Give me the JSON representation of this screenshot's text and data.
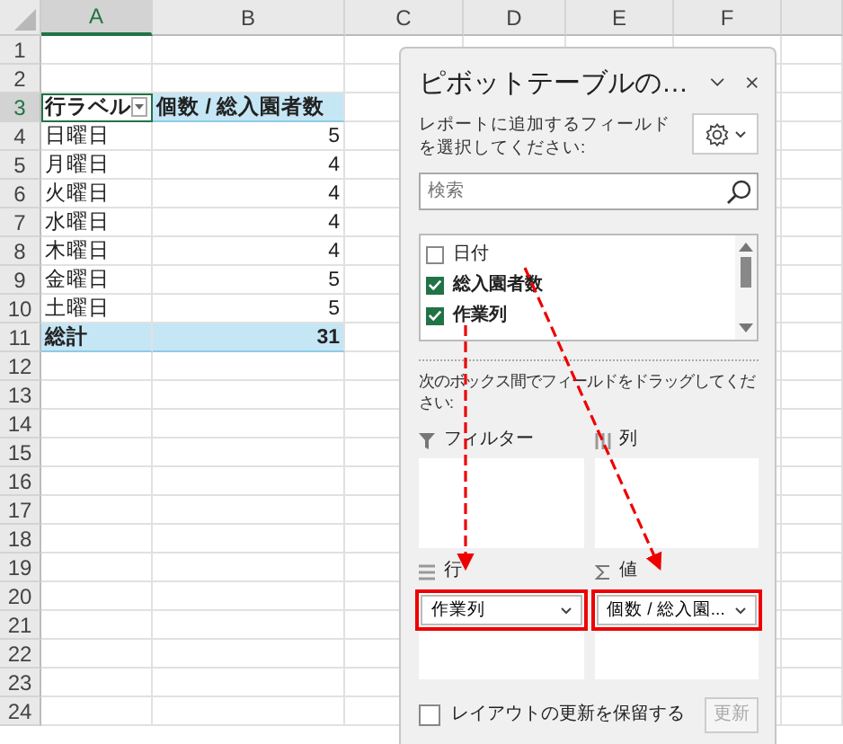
{
  "column_headers": [
    {
      "label": "A",
      "selected": true
    },
    {
      "label": "B",
      "selected": false
    },
    {
      "label": "C",
      "selected": false
    },
    {
      "label": "D",
      "selected": false
    },
    {
      "label": "E",
      "selected": false
    },
    {
      "label": "F",
      "selected": false
    }
  ],
  "row_headers": [
    {
      "label": "1",
      "selected": false
    },
    {
      "label": "2",
      "selected": false
    },
    {
      "label": "3",
      "selected": true
    },
    {
      "label": "4",
      "selected": false
    },
    {
      "label": "5",
      "selected": false
    },
    {
      "label": "6",
      "selected": false
    },
    {
      "label": "7",
      "selected": false
    },
    {
      "label": "8",
      "selected": false
    },
    {
      "label": "9",
      "selected": false
    },
    {
      "label": "10",
      "selected": false
    },
    {
      "label": "11",
      "selected": false
    },
    {
      "label": "12",
      "selected": false
    },
    {
      "label": "13",
      "selected": false
    },
    {
      "label": "14",
      "selected": false
    },
    {
      "label": "15",
      "selected": false
    },
    {
      "label": "16",
      "selected": false
    },
    {
      "label": "17",
      "selected": false
    },
    {
      "label": "18",
      "selected": false
    },
    {
      "label": "19",
      "selected": false
    },
    {
      "label": "20",
      "selected": false
    },
    {
      "label": "21",
      "selected": false
    },
    {
      "label": "22",
      "selected": false
    },
    {
      "label": "23",
      "selected": false
    },
    {
      "label": "24",
      "selected": false
    }
  ],
  "pivot": {
    "row_label": "行ラベル",
    "value_label": "個数 / 総入園者数",
    "rows": [
      {
        "label": "日曜日",
        "value": "5"
      },
      {
        "label": "月曜日",
        "value": "4"
      },
      {
        "label": "火曜日",
        "value": "4"
      },
      {
        "label": "水曜日",
        "value": "4"
      },
      {
        "label": "木曜日",
        "value": "4"
      },
      {
        "label": "金曜日",
        "value": "5"
      },
      {
        "label": "土曜日",
        "value": "5"
      }
    ],
    "total": {
      "label": "総計",
      "value": "31"
    }
  },
  "panel": {
    "title": "ピボットテーブルの…",
    "instruction": "レポートに追加するフィールドを選択してください:",
    "search": {
      "placeholder": "検索"
    },
    "fields": [
      {
        "label": "日付",
        "checked": false
      },
      {
        "label": "総入園者数",
        "checked": true
      },
      {
        "label": "作業列",
        "checked": true
      }
    ],
    "drag_instruction": "次のボックス間でフィールドをドラッグしてください:",
    "areas": [
      {
        "kind": "filter",
        "label": "フィルター"
      },
      {
        "kind": "columns",
        "label": "列"
      },
      {
        "kind": "rows",
        "label": "行",
        "items": [
          {
            "label": "作業列",
            "highlighted": true
          }
        ]
      },
      {
        "kind": "values",
        "label": "値",
        "items": [
          {
            "label": "個数 / 総入園...",
            "highlighted": true
          }
        ]
      }
    ],
    "defer_update": {
      "label": "レイアウトの更新を保留する",
      "checked": false
    },
    "update_button": {
      "label": "更新",
      "disabled": true
    }
  }
}
